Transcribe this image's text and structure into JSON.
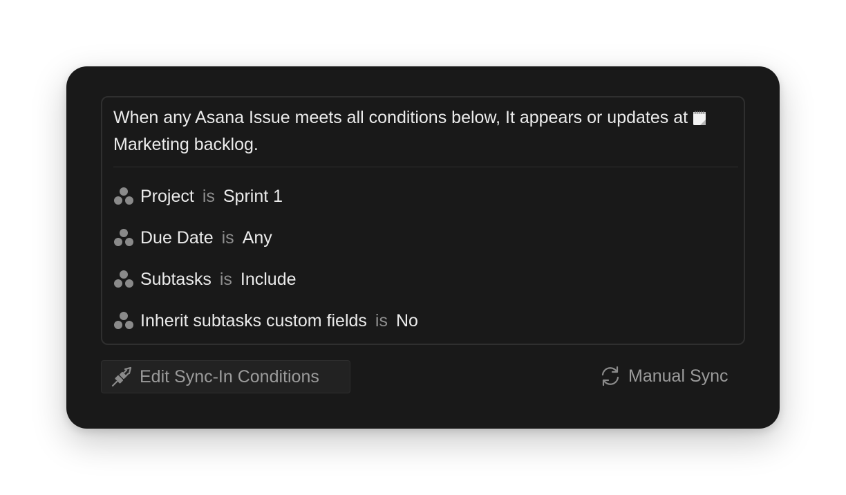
{
  "summary": {
    "text_before": "When any Asana Issue meets all conditions below, It appears or updates at",
    "database_icon": "notepad-icon",
    "database_name": "Marketing backlog."
  },
  "conditions": [
    {
      "icon": "asana-icon",
      "field": "Project",
      "operator": "is",
      "value": "Sprint 1"
    },
    {
      "icon": "asana-icon",
      "field": "Due Date",
      "operator": "is",
      "value": "Any"
    },
    {
      "icon": "asana-icon",
      "field": "Subtasks",
      "operator": "is",
      "value": "Include"
    },
    {
      "icon": "asana-icon",
      "field": "Inherit subtasks custom fields",
      "operator": "is",
      "value": "No"
    }
  ],
  "actions": {
    "edit": {
      "icon": "plug-icon",
      "label": "Edit Sync-In Conditions"
    },
    "sync": {
      "icon": "sync-icon",
      "label": "Manual Sync"
    }
  },
  "colors": {
    "card_background": "#191919",
    "text_primary": "#ebebeb",
    "text_muted": "#9b9b9b",
    "operator": "#8e8e8e",
    "border": "#2f2f2f"
  }
}
